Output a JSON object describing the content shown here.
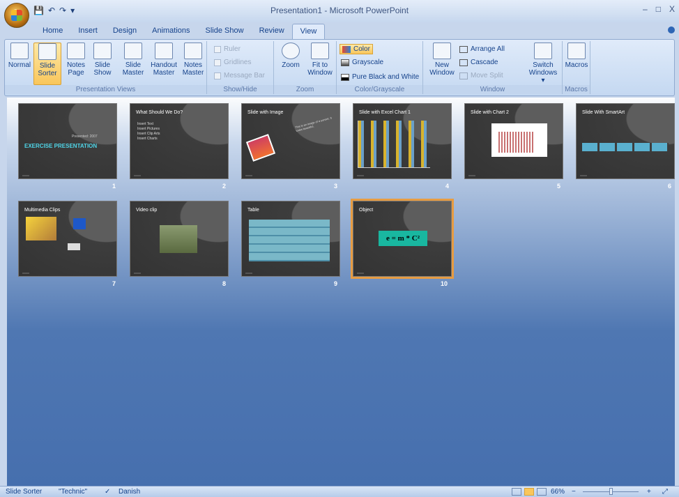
{
  "window": {
    "title": "Presentation1 - Microsoft PowerPoint",
    "minimize": "–",
    "maximize": "□",
    "close": "X"
  },
  "qat": {
    "save": "💾",
    "undo": "↶",
    "redo": "↷",
    "customize": "▾"
  },
  "tabs": [
    "Home",
    "Insert",
    "Design",
    "Animations",
    "Slide Show",
    "Review",
    "View"
  ],
  "active_tab": "View",
  "ribbon": {
    "presentation_views": {
      "label": "Presentation Views",
      "buttons": [
        {
          "line1": "Normal",
          "line2": ""
        },
        {
          "line1": "Slide",
          "line2": "Sorter"
        },
        {
          "line1": "Notes",
          "line2": "Page"
        },
        {
          "line1": "Slide",
          "line2": "Show"
        },
        {
          "line1": "Slide",
          "line2": "Master"
        },
        {
          "line1": "Handout",
          "line2": "Master"
        },
        {
          "line1": "Notes",
          "line2": "Master"
        }
      ]
    },
    "show_hide": {
      "label": "Show/Hide",
      "items": [
        "Ruler",
        "Gridlines",
        "Message Bar"
      ]
    },
    "zoom": {
      "label": "Zoom",
      "zoom_btn": "Zoom",
      "fit1": "Fit to",
      "fit2": "Window"
    },
    "color_grayscale": {
      "label": "Color/Grayscale",
      "items": [
        "Color",
        "Grayscale",
        "Pure Black and White"
      ]
    },
    "window": {
      "label": "Window",
      "new1": "New",
      "new2": "Window",
      "arrange_all": "Arrange All",
      "cascade": "Cascade",
      "move_split": "Move Split",
      "switch1": "Switch",
      "switch2": "Windows ▾"
    },
    "macros": {
      "label": "Macros",
      "btn": "Macros"
    }
  },
  "slides": [
    {
      "num": "1",
      "title": "EXERCISE PRESENTATION",
      "sub": "Presented: 2007"
    },
    {
      "num": "2",
      "title": "What Should We Do?",
      "bullets": [
        "Insert Text",
        "Insert Pictures",
        "Insert Clip Arts",
        "Insert Charts"
      ]
    },
    {
      "num": "3",
      "title": "Slide with Image",
      "caption": "This is an image of a sunset. It looks beautiful."
    },
    {
      "num": "4",
      "title": "Slide with Excel Chart 1"
    },
    {
      "num": "5",
      "title": "Slide with Chart 2"
    },
    {
      "num": "6",
      "title": "Slide With SmartArt"
    },
    {
      "num": "7",
      "title": "Multimedia Clips"
    },
    {
      "num": "8",
      "title": "Video clip"
    },
    {
      "num": "9",
      "title": "Table"
    },
    {
      "num": "10",
      "title": "Object",
      "equation": "e = m * C²"
    }
  ],
  "statusbar": {
    "view": "Slide Sorter",
    "theme": "\"Technic\"",
    "language": "Danish",
    "zoom": "66%",
    "zoom_out": "−",
    "zoom_in": "+"
  }
}
